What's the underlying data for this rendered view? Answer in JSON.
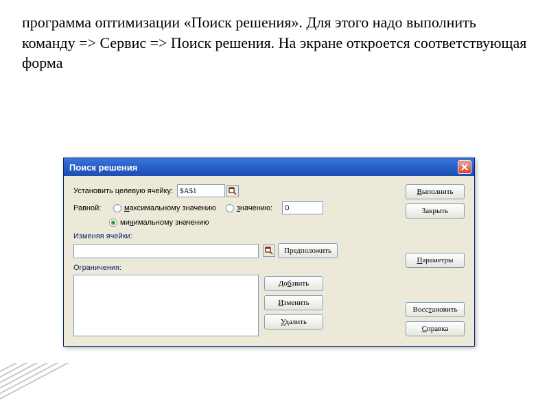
{
  "slide": {
    "paragraph": "   программа оптимизации «Поиск решения». Для этого надо выполнить команду => Сервис => Поиск решения. На экране откроется соответствующая форма"
  },
  "dialog": {
    "title": "Поиск решения",
    "target_label": "Установить целевую ячейку:",
    "target_value": "$A$1",
    "equal_label": "Равной:",
    "radio_max": "максимальному значению",
    "radio_value": "значению:",
    "radio_min": "минимальному значению",
    "value_input": "0",
    "changing_label": "Изменяя ячейки:",
    "constraints_label": "Ограничения:",
    "buttons": {
      "execute": "Выполнить",
      "close": "Закрыть",
      "guess": "Предположить",
      "params": "Параметры",
      "add": "Добавить",
      "change": "Изменить",
      "delete": "Удалить",
      "restore": "Восстановить",
      "help": "Справка"
    }
  }
}
